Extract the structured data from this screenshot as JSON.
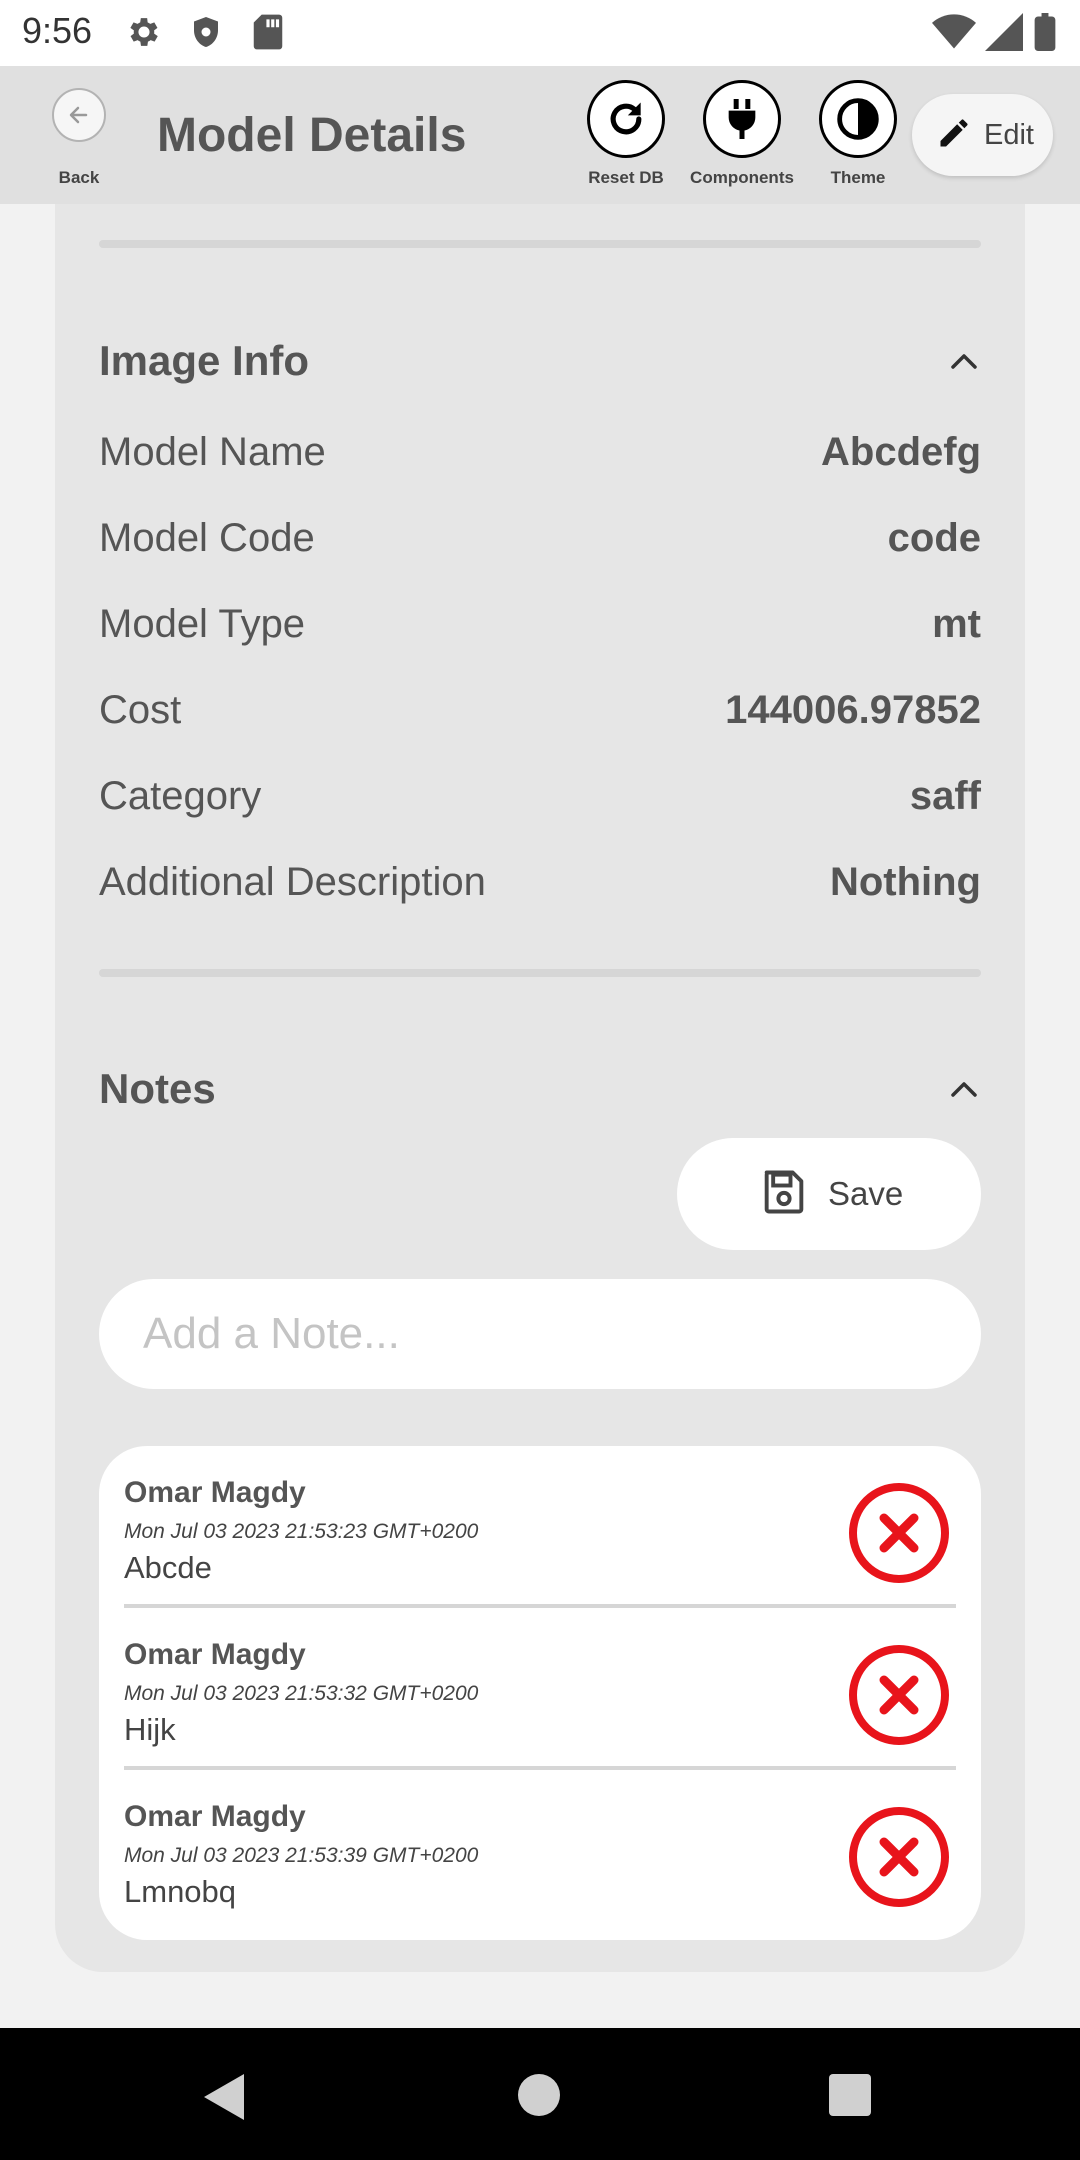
{
  "status_bar": {
    "time": "9:56",
    "icons": [
      "gear-icon",
      "shield-icon",
      "sd-card-icon",
      "wifi-icon",
      "signal-icon",
      "battery-icon"
    ]
  },
  "app_bar": {
    "back_label": "Back",
    "title": "Model Details",
    "tools": [
      {
        "label": "Reset DB",
        "icon": "refresh-icon"
      },
      {
        "label": "Components",
        "icon": "plug-icon"
      },
      {
        "label": "Theme",
        "icon": "theme-icon"
      }
    ],
    "edit_label": "Edit"
  },
  "image_info": {
    "title": "Image Info",
    "rows": [
      {
        "label": "Model Name",
        "value": "Abcdefg"
      },
      {
        "label": "Model Code",
        "value": "code"
      },
      {
        "label": "Model Type",
        "value": "mt"
      },
      {
        "label": "Cost",
        "value": "144006.97852"
      },
      {
        "label": "Category",
        "value": "saff"
      },
      {
        "label": "Additional Description",
        "value": "Nothing"
      }
    ]
  },
  "notes": {
    "title": "Notes",
    "save_label": "Save",
    "input_placeholder": "Add a Note...",
    "input_value": "",
    "items": [
      {
        "author": "Omar Magdy",
        "date": "Mon Jul 03 2023 21:53:23 GMT+0200",
        "text": "Abcde"
      },
      {
        "author": "Omar Magdy",
        "date": "Mon Jul 03 2023 21:53:32 GMT+0200",
        "text": "Hijk"
      },
      {
        "author": "Omar Magdy",
        "date": "Mon Jul 03 2023 21:53:39 GMT+0200",
        "text": "Lmnobq"
      }
    ]
  },
  "colors": {
    "delete_red": "#e8141b",
    "app_bar_bg": "#e0e0e0",
    "card_bg": "#e6e6e6"
  }
}
